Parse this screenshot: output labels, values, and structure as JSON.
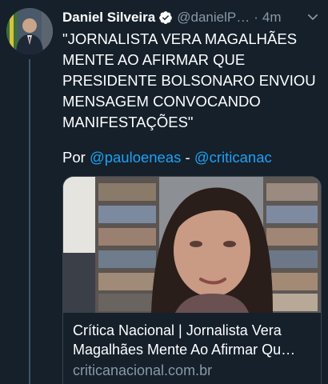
{
  "tweet": {
    "display_name": "Daniel Silveira",
    "handle": "@danielP…",
    "separator": "·",
    "time": "4m",
    "text": "\"JORNALISTA VERA MAGALHÃES MENTE AO AFIRMAR QUE PRESIDENTE BOLSONARO ENVIOU MENSAGEM CONVOCANDO MANIFESTAÇÕES\"",
    "credit_prefix": "Por",
    "credit_link_1": "@pauloeneas",
    "credit_dash": "-",
    "credit_link_2": "@criticanac"
  },
  "card": {
    "title": "Crítica Nacional | Jornalista Vera Magalhães Mente Ao Afirmar Qu…",
    "domain": "criticanacional.com.br"
  },
  "colors": {
    "background": "#15202b",
    "link": "#1da1f2",
    "secondary_text": "#8899a6",
    "border": "#38444d"
  },
  "icons": [
    "verified-badge-icon",
    "chevron-down-icon"
  ]
}
